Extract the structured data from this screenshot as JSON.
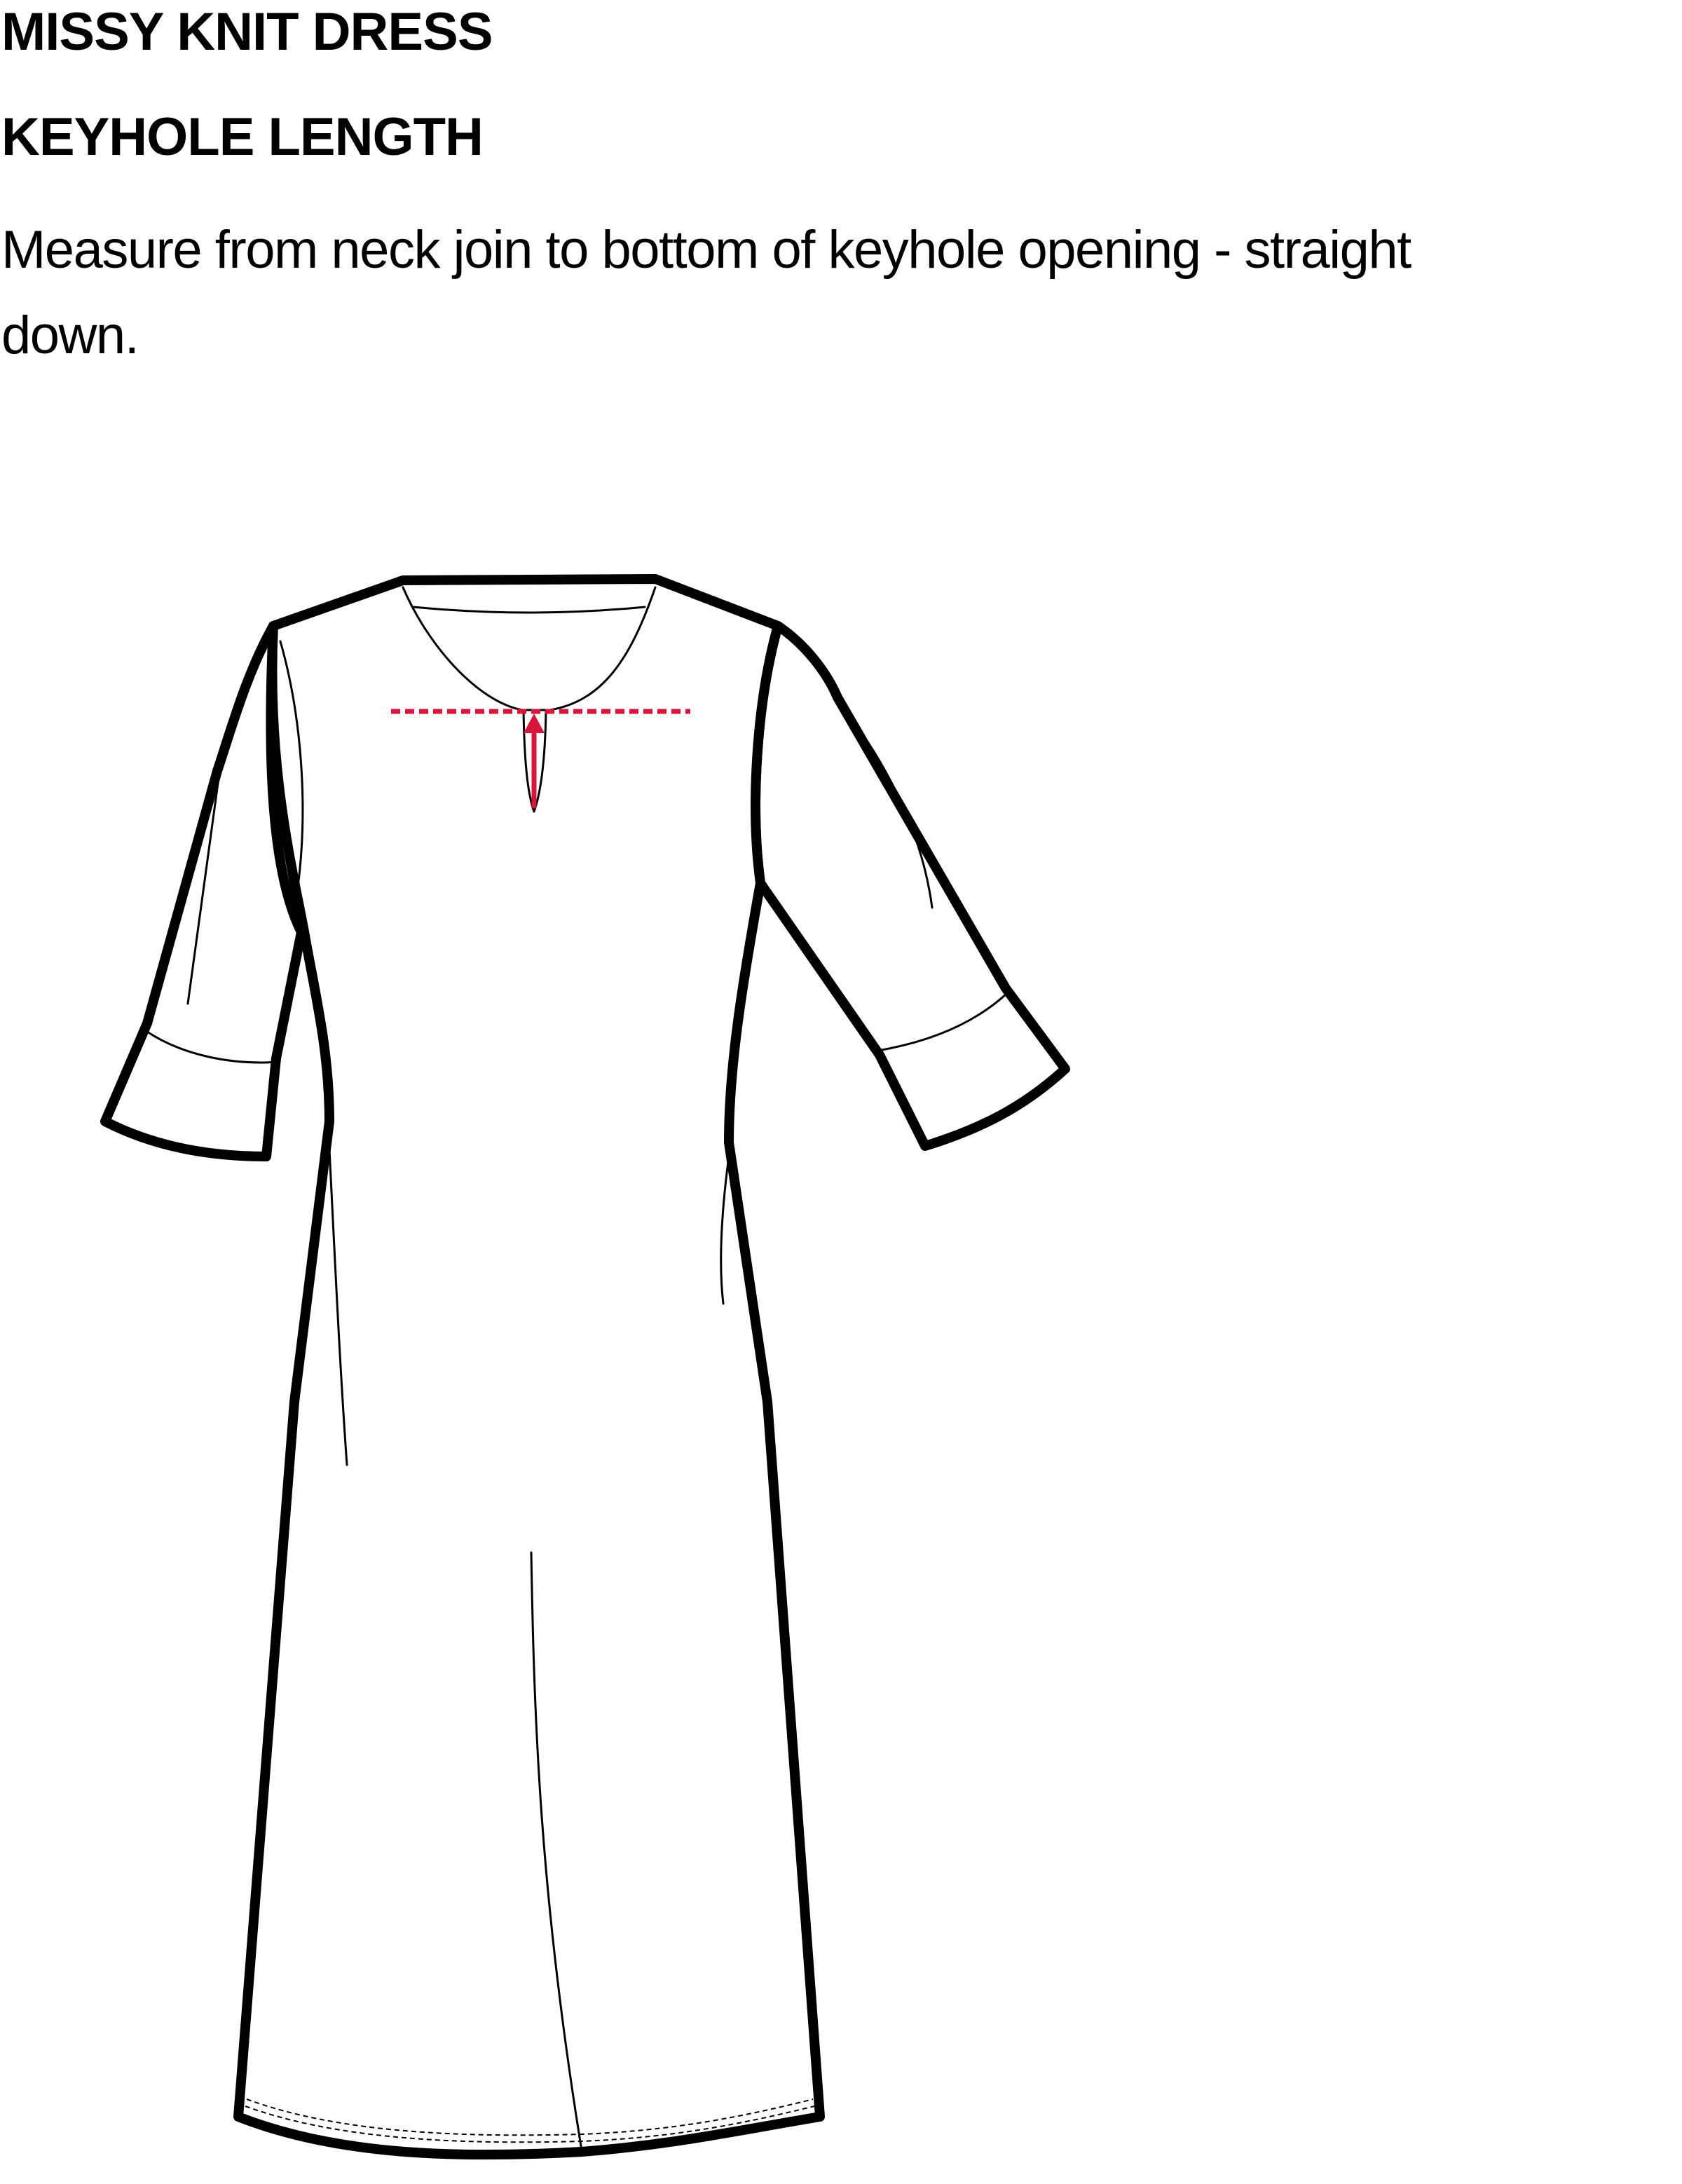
{
  "header": {
    "title": "MISSY KNIT DRESS",
    "subtitle": "KEYHOLE LENGTH",
    "instruction": "Measure from neck join to bottom of keyhole opening - straight down."
  },
  "colors": {
    "measurement": "#d6173b",
    "outline": "#000000",
    "background": "#ffffff"
  },
  "icons": {
    "garment": "dress-flat-sketch-icon",
    "measurement": "up-arrow-icon"
  }
}
